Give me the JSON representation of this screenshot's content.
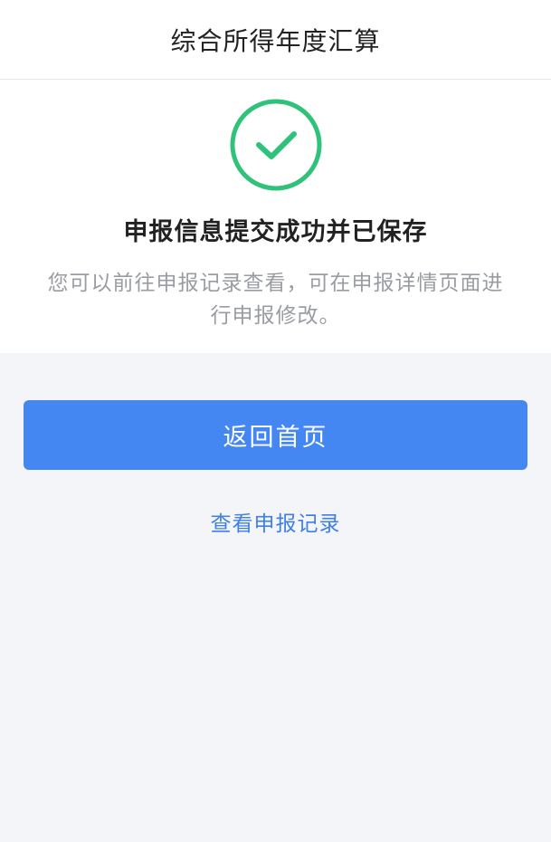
{
  "header": {
    "title": "综合所得年度汇算"
  },
  "result": {
    "icon": "check-circle-icon",
    "title": "申报信息提交成功并已保存",
    "description": "您可以前往申报记录查看，可在申报详情页面进行申报修改。"
  },
  "actions": {
    "primary_label": "返回首页",
    "secondary_label": "查看申报记录"
  },
  "colors": {
    "background": "#f4f5f9",
    "success": "#2fc27b",
    "primary": "#4487f3",
    "link": "#3f7fe8",
    "muted_text": "#9a9ca3"
  }
}
